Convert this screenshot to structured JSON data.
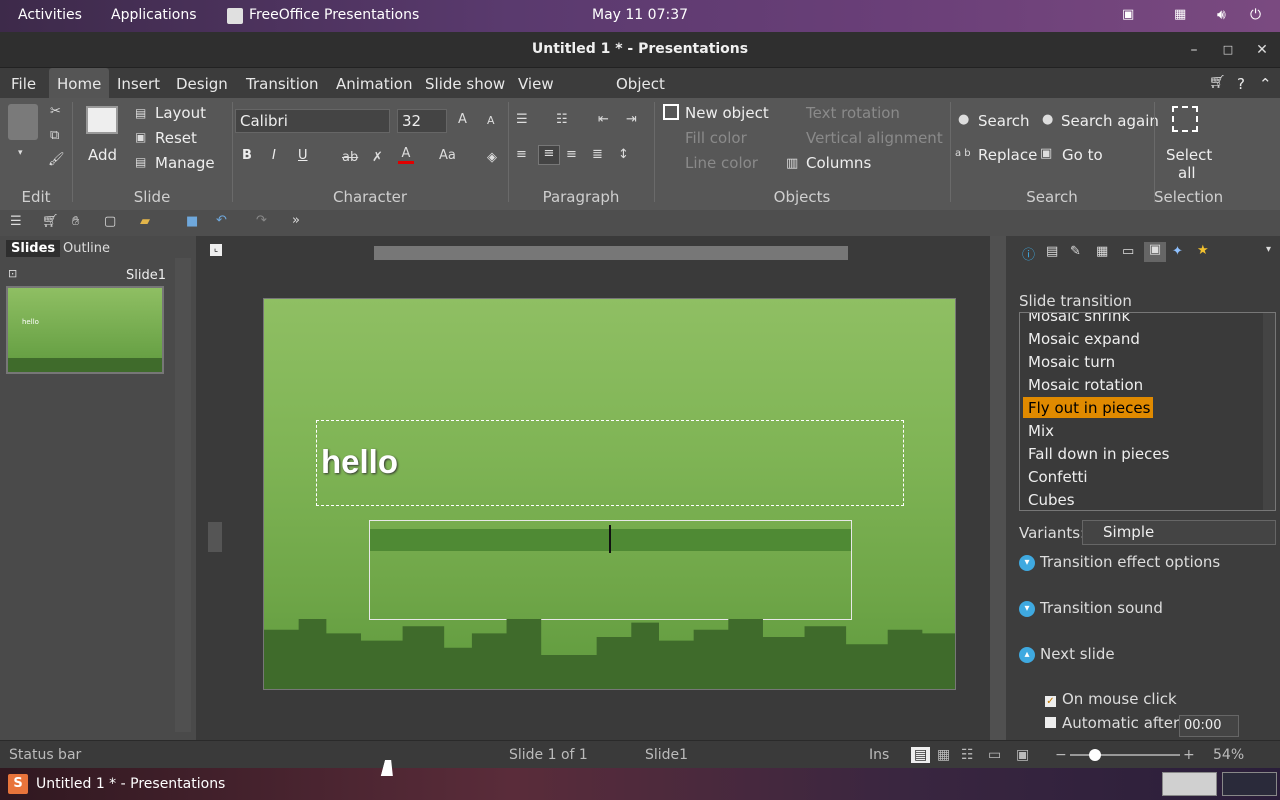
{
  "topbar": {
    "activities": "Activities",
    "applications": "Applications",
    "app_name": "FreeOffice Presentations",
    "clock": "May 11  07:37"
  },
  "window": {
    "title": "Untitled 1 * - Presentations",
    "minimize": "–",
    "maximize": "□",
    "close": "✕"
  },
  "menu": {
    "file": "File",
    "home": "Home",
    "insert": "Insert",
    "design": "Design",
    "transition": "Transition",
    "animation": "Animation",
    "slideshow": "Slide show",
    "view": "View",
    "object": "Object",
    "help": "?"
  },
  "ribbon": {
    "edit": {
      "group": "Edit"
    },
    "slide": {
      "add": "Add",
      "layout": "Layout",
      "reset": "Reset",
      "manage": "Manage",
      "group": "Slide"
    },
    "character": {
      "font": "Calibri",
      "size": "32",
      "group": "Character",
      "bold": "B",
      "italic": "I",
      "underline": "U"
    },
    "paragraph": {
      "group": "Paragraph"
    },
    "objects": {
      "new_object": "New object",
      "fill_color": "Fill color",
      "line_color": "Line color",
      "text_rotation": "Text rotation",
      "vertical_alignment": "Vertical alignment",
      "columns": "Columns",
      "group": "Objects"
    },
    "search": {
      "search": "Search",
      "search_again": "Search again",
      "replace": "Replace",
      "go_to": "Go to",
      "group": "Search"
    },
    "selection": {
      "select_all_line1": "Select",
      "select_all_line2": "all",
      "group": "Selection"
    }
  },
  "leftpanel": {
    "tab_slides": "Slides",
    "tab_outline": "Outline",
    "slide_label": "Slide1",
    "thumb_text": "hello"
  },
  "slide": {
    "title_text": "hello"
  },
  "sidebar": {
    "heading": "Slide transition",
    "transitions": [
      "Mosaic shrink",
      "Mosaic expand",
      "Mosaic turn",
      "Mosaic rotation",
      "Fly out in pieces",
      "Mix",
      "Fall down in pieces",
      "Confetti",
      "Cubes"
    ],
    "selected": "Fly out in pieces",
    "variants_label": "Variants:",
    "variant_value": "Simple",
    "effect_options": "Transition effect options",
    "sound": "Transition sound",
    "next_slide": "Next slide",
    "on_mouse_click": "On mouse click",
    "automatic_after": "Automatic after:",
    "auto_time": "00:00"
  },
  "status": {
    "label": "Status bar",
    "slide_count": "Slide 1 of 1",
    "slide_name": "Slide1",
    "mode": "Ins",
    "zoom": "54%"
  },
  "taskbar": {
    "item": "Untitled 1 * - Presentations"
  }
}
